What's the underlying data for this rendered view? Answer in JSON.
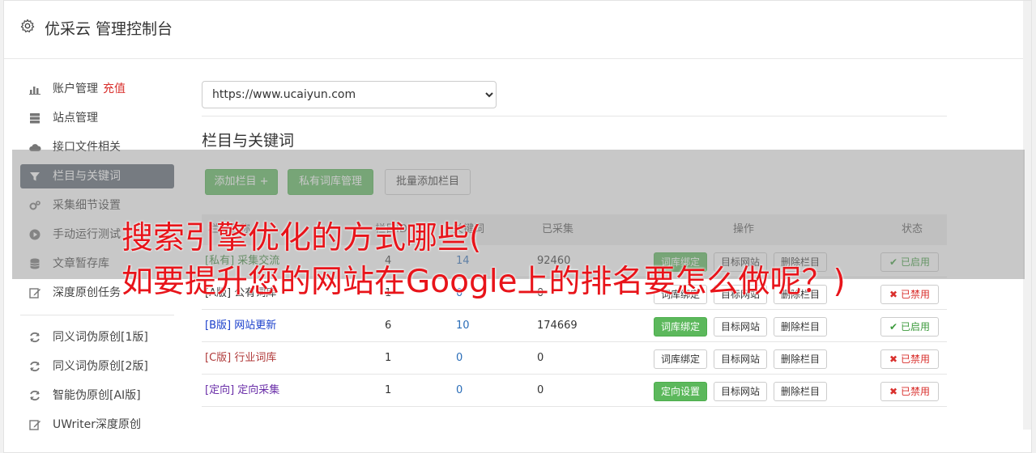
{
  "app": {
    "title": "优采云 管理控制台"
  },
  "sidebar": {
    "items": [
      {
        "label": "账户管理",
        "extra": "充值",
        "icon": "bar-chart-icon"
      },
      {
        "label": "站点管理",
        "icon": "server-icon"
      },
      {
        "label": "接口文件相关",
        "icon": "cloud-icon"
      },
      {
        "label": "栏目与关键词",
        "icon": "filter-icon",
        "active": true
      },
      {
        "label": "采集细节设置",
        "icon": "gears-icon"
      },
      {
        "label": "手动运行测试",
        "icon": "play-icon"
      },
      {
        "label": "文章暂存库",
        "icon": "database-icon"
      },
      {
        "label": "深度原创任务",
        "icon": "edit-icon"
      }
    ],
    "items2": [
      {
        "label": "同义词伪原创[1版]",
        "icon": "refresh-icon"
      },
      {
        "label": "同义词伪原创[2版]",
        "icon": "refresh-icon"
      },
      {
        "label": "智能伪原创[AI版]",
        "icon": "refresh-icon"
      },
      {
        "label": "UWriter深度原创",
        "icon": "edit-icon"
      }
    ]
  },
  "main": {
    "site_select": {
      "value": "https://www.ucaiyun.com"
    },
    "section_title": "栏目与关键词",
    "buttons": {
      "add_column": "添加栏目 +",
      "private_lib": "私有词库管理",
      "batch_add": "批量添加栏目"
    },
    "table": {
      "headers": {
        "name": "栏目名称",
        "id": "栏目ID",
        "keywords": "关键词",
        "collected": "已采集",
        "actions": "操作",
        "status": "状态"
      },
      "rows": [
        {
          "tag": "[私有]",
          "name": "采集交流",
          "id": "4",
          "kw": "14",
          "collected": "92460",
          "bind": "词库绑定",
          "bind_green": true,
          "target": "目标网站",
          "delete": "删除栏目",
          "status": "已启用",
          "enabled": true,
          "cls": "name-private"
        },
        {
          "tag": "[A版]",
          "name": "公有词库",
          "id": "1",
          "kw": "0",
          "collected": "0",
          "bind": "词库绑定",
          "bind_green": false,
          "target": "目标网站",
          "delete": "删除栏目",
          "status": "已禁用",
          "enabled": false,
          "cls": "name-a"
        },
        {
          "tag": "[B版]",
          "name": "网站更新",
          "id": "6",
          "kw": "10",
          "collected": "174669",
          "bind": "词库绑定",
          "bind_green": true,
          "target": "目标网站",
          "delete": "删除栏目",
          "status": "已启用",
          "enabled": true,
          "cls": "name-b"
        },
        {
          "tag": "[C版]",
          "name": "行业词库",
          "id": "1",
          "kw": "0",
          "collected": "0",
          "bind": "词库绑定",
          "bind_green": false,
          "target": "目标网站",
          "delete": "删除栏目",
          "status": "已禁用",
          "enabled": false,
          "cls": "name-c"
        },
        {
          "tag": "[定向]",
          "name": "定向采集",
          "id": "1",
          "kw": "0",
          "collected": "0",
          "bind": "定向设置",
          "bind_green": true,
          "target": "目标网站",
          "delete": "删除栏目",
          "status": "已禁用",
          "enabled": false,
          "cls": "name-dir"
        }
      ]
    }
  },
  "overlay": {
    "line1": "搜索引擎优化的方式哪些(",
    "line2": "如要提升您的网站在Google上的排名要怎么做呢？)"
  },
  "colors": {
    "accent_green": "#5cb85c",
    "danger_red": "#d9302d",
    "active_nav": "#5b6470",
    "overlay_text": "#e8141a"
  }
}
